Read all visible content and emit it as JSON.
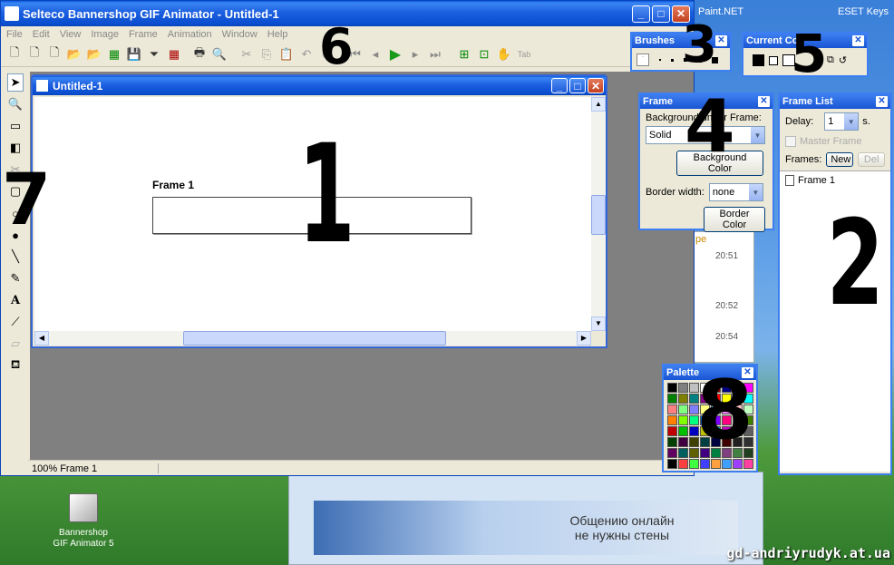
{
  "app": {
    "title": "Selteco Bannershop GIF Animator - Untitled-1"
  },
  "desktop": {
    "paint_label": "Paint.NET",
    "eset_label": "ESET Keys",
    "icon_label_1": "Bannershop",
    "icon_label_2": "GIF Animator 5",
    "watermark": "gd-andriyrudyk.at.ua",
    "ad_line1": "Общению онлайн",
    "ad_line2": "не нужны стены",
    "chat_times": [
      "20:51",
      "20:52",
      "20:54"
    ],
    "chat_letter": "pe"
  },
  "menu": [
    "File",
    "Edit",
    "View",
    "Image",
    "Frame",
    "Animation",
    "Window",
    "Help"
  ],
  "document": {
    "title": "Untitled-1",
    "frame_label": "Frame 1"
  },
  "status": {
    "text": "100% Frame 1"
  },
  "brushes": {
    "title": "Brushes"
  },
  "current_colors": {
    "title": "Current Colors",
    "visible_text": "Current Co"
  },
  "frame_panel": {
    "title": "Frame",
    "bg_label": "Background under Frame:",
    "bg_value": "Solid",
    "bg_color_button": "Background Color",
    "border_width_label": "Border width:",
    "border_width_value": "none",
    "border_color_button": "Border Color"
  },
  "frame_list": {
    "title": "Frame List",
    "delay_label": "Delay:",
    "delay_value": "1",
    "delay_unit": "s.",
    "master_frame_label": "Master Frame",
    "frames_label": "Frames:",
    "new_button": "New",
    "del_button": "Del",
    "items": [
      "Frame 1"
    ]
  },
  "palette": {
    "title": "Palette",
    "colors": [
      "#000000",
      "#808080",
      "#c0c0c0",
      "#ffffff",
      "#800000",
      "#000080",
      "#0000ff",
      "#ff00ff",
      "#008000",
      "#808000",
      "#008080",
      "#800080",
      "#ff0000",
      "#ffff00",
      "#00ff00",
      "#00ffff",
      "#ff8080",
      "#80ff80",
      "#8080ff",
      "#ffff80",
      "#80ffff",
      "#ff80ff",
      "#ffc0c0",
      "#c0ffc0",
      "#ff8000",
      "#80ff00",
      "#00ff80",
      "#0080ff",
      "#8000ff",
      "#ff0080",
      "#804000",
      "#408000",
      "#c00000",
      "#00c000",
      "#0000c0",
      "#c0c000",
      "#00c0c0",
      "#c000c0",
      "#404040",
      "#606060",
      "#004000",
      "#400040",
      "#404000",
      "#004040",
      "#000040",
      "#400000",
      "#202020",
      "#303030",
      "#600060",
      "#006060",
      "#606000",
      "#400080",
      "#008040",
      "#804080",
      "#408040",
      "#204020",
      "#000000",
      "#ff4040",
      "#40ff40",
      "#4040ff",
      "#ffa040",
      "#40a0ff",
      "#a040ff",
      "#ff40a0"
    ]
  },
  "annotations": [
    "1",
    "2",
    "3",
    "4",
    "5",
    "6",
    "7",
    "8"
  ]
}
